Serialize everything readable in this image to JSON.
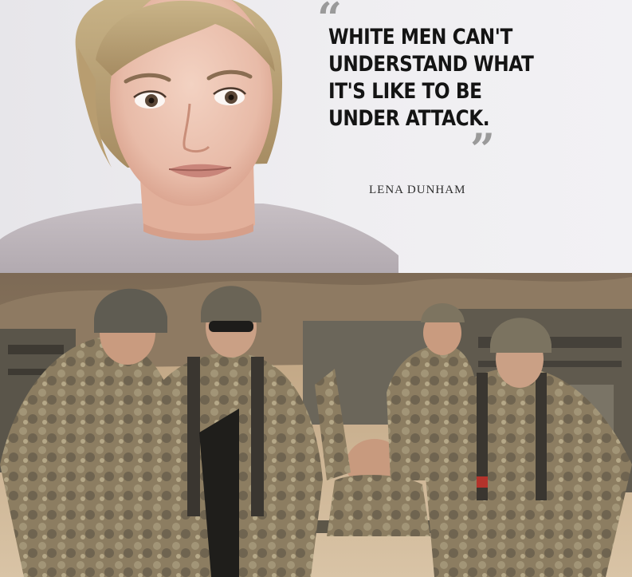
{
  "quote": {
    "open_mark": "“",
    "lines": [
      "WHITE MEN CAN'T",
      "UNDERSTAND WHAT",
      "IT'S LIKE TO BE",
      "UNDER ATTACK."
    ],
    "close_mark": "”"
  },
  "attribution": "LENA DUNHAM",
  "colors": {
    "panel_background": "#ecebee",
    "quote_text": "#141414",
    "quote_marks": "#9a9a9a",
    "desert_sand": "#b59a78",
    "camouflage": "#8c7d61"
  },
  "images": {
    "top": "portrait of a blonde woman in a light grey top",
    "bottom": "soldiers in desert camouflage carrying a wounded comrade on a litter past armored vehicles"
  }
}
